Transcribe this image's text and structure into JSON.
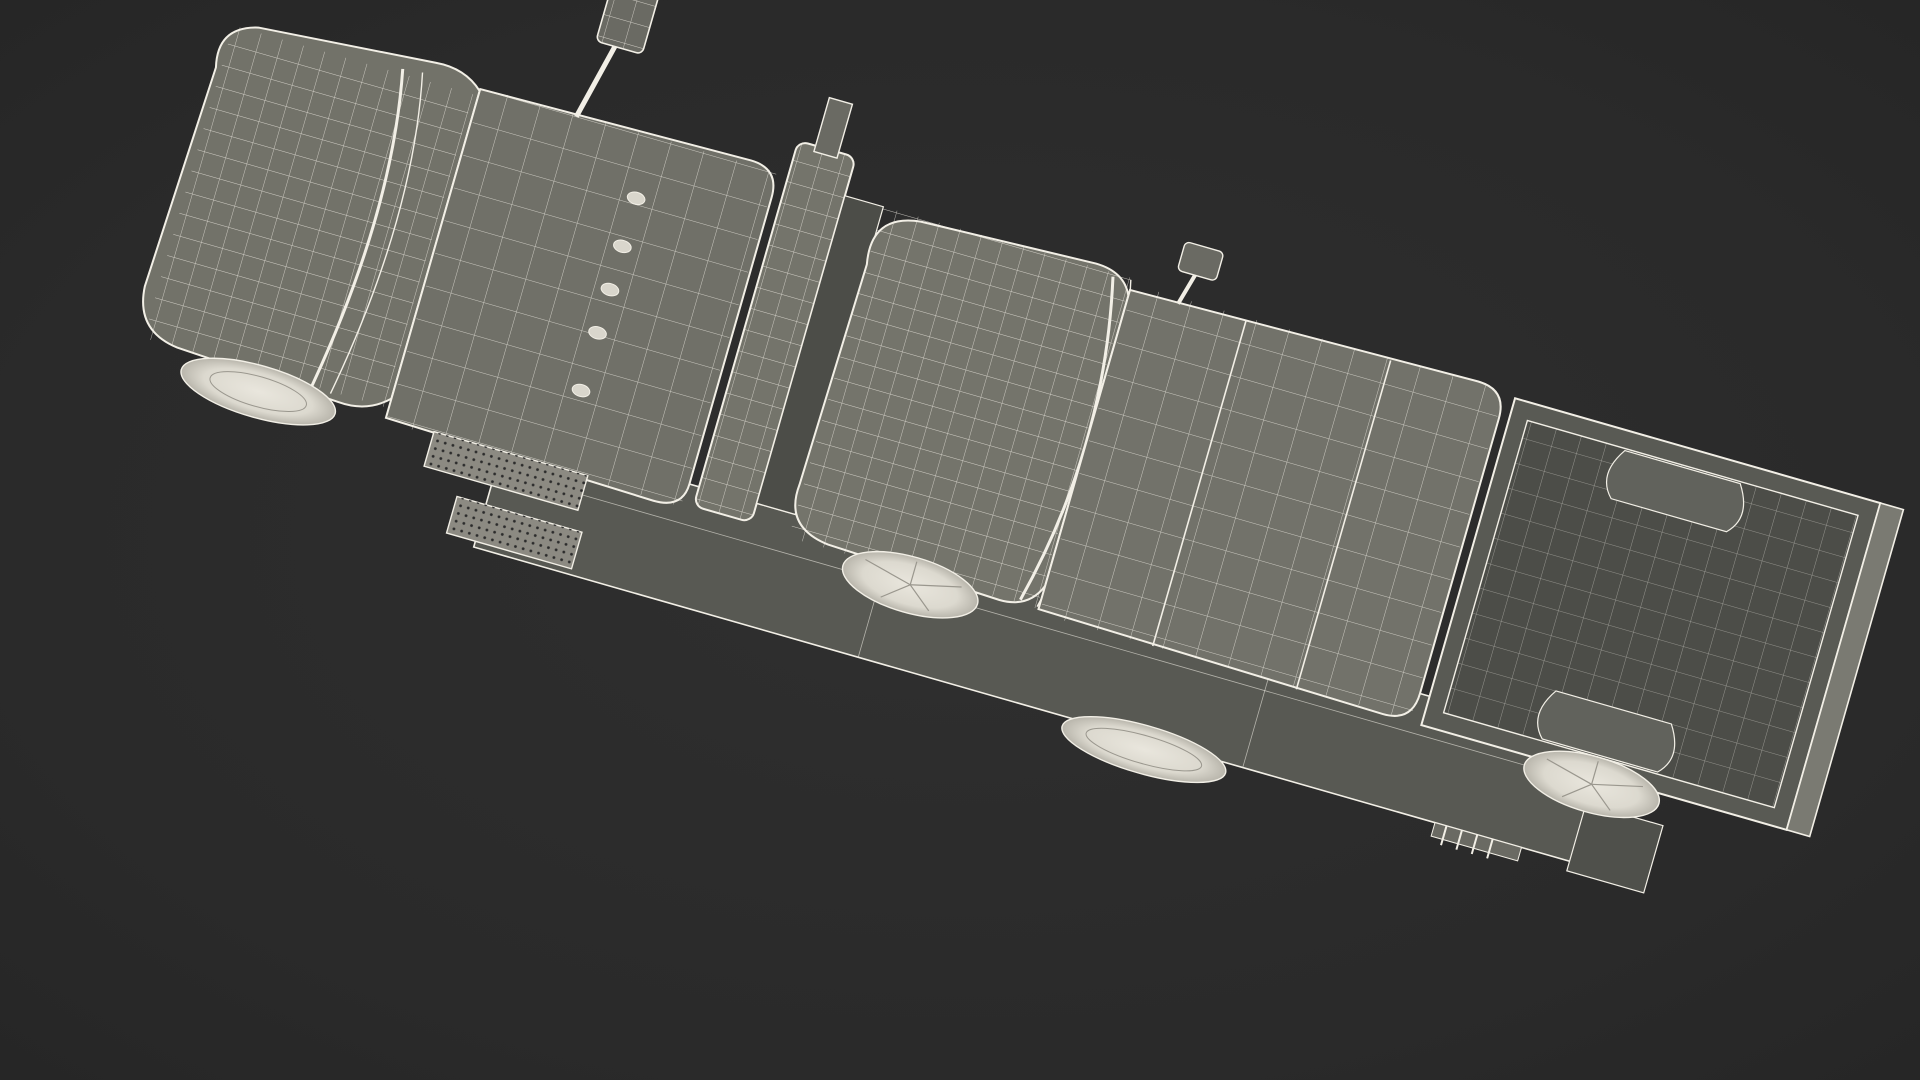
{
  "scene": {
    "background_color": "#2b2b2b",
    "wire_color": "#f2efe6",
    "surface_color": "#6f6f68",
    "surface_dark": "#4f504b",
    "surface_light": "#8a8a82",
    "deck_color": "#5b5c57"
  }
}
